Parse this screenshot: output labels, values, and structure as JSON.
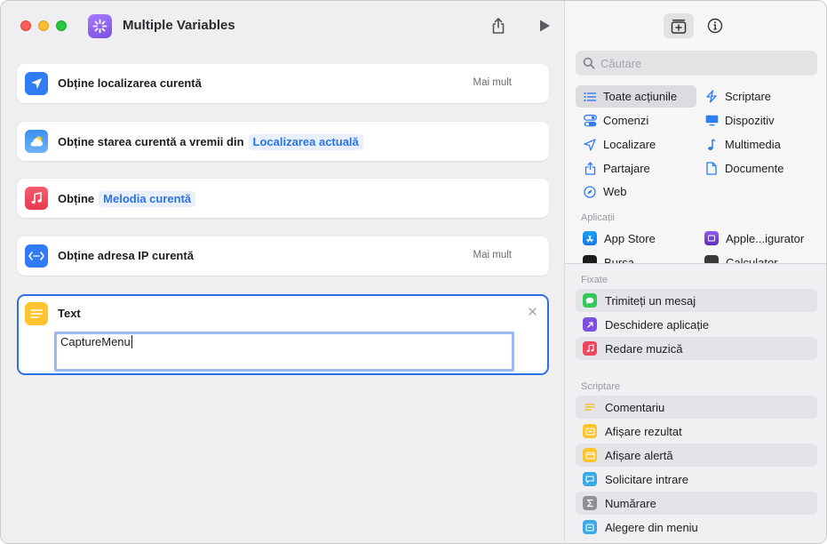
{
  "window": {
    "title": "Multiple Variables"
  },
  "workflow": {
    "actions": [
      {
        "title": "Obține localizarea curentă",
        "token": "",
        "more": "Mai mult"
      },
      {
        "title": "Obține starea curentă a vremii din",
        "token": "Localizarea actuală",
        "more": ""
      },
      {
        "title": "Obține",
        "token": "Melodia curentă",
        "more": ""
      },
      {
        "title": "Obține adresa IP curentă",
        "token": "",
        "more": "Mai mult"
      }
    ],
    "text_action": {
      "title": "Text",
      "value": "CaptureMenu"
    }
  },
  "library": {
    "search_placeholder": "Căutare",
    "categories": [
      {
        "label": "Toate acțiunile",
        "icon": "list-icon",
        "selected": true
      },
      {
        "label": "Scriptare",
        "icon": "scripting-icon"
      },
      {
        "label": "Comenzi",
        "icon": "controls-icon"
      },
      {
        "label": "Dispozitiv",
        "icon": "device-icon"
      },
      {
        "label": "Localizare",
        "icon": "location-icon"
      },
      {
        "label": "Multimedia",
        "icon": "music-note-icon"
      },
      {
        "label": "Partajare",
        "icon": "share-icon"
      },
      {
        "label": "Documente",
        "icon": "document-icon"
      },
      {
        "label": "Web",
        "icon": "compass-icon"
      }
    ],
    "apps_label": "Aplicații",
    "apps": [
      {
        "label": "App Store"
      },
      {
        "label": "Apple...igurator"
      },
      {
        "label": "Bursa"
      },
      {
        "label": "Calculator"
      }
    ],
    "pinned_label": "Fixate",
    "pinned": [
      {
        "label": "Trimiteți un mesaj",
        "color": "#34c759"
      },
      {
        "label": "Deschidere aplicație",
        "color": "#7d4fe0"
      },
      {
        "label": "Redare muzică",
        "color": "#f0455a"
      }
    ],
    "scripting_label": "Scriptare",
    "scripting": [
      {
        "label": "Comentariu",
        "color": "#ffd140"
      },
      {
        "label": "Afișare rezultat",
        "color": "#ffc42e"
      },
      {
        "label": "Afișare alertă",
        "color": "#ffc42e"
      },
      {
        "label": "Solicitare intrare",
        "color": "#3aa9e8"
      },
      {
        "label": "Numărare",
        "color": "#8e8e93"
      },
      {
        "label": "Alegere din meniu",
        "color": "#3aa9e8"
      }
    ]
  }
}
